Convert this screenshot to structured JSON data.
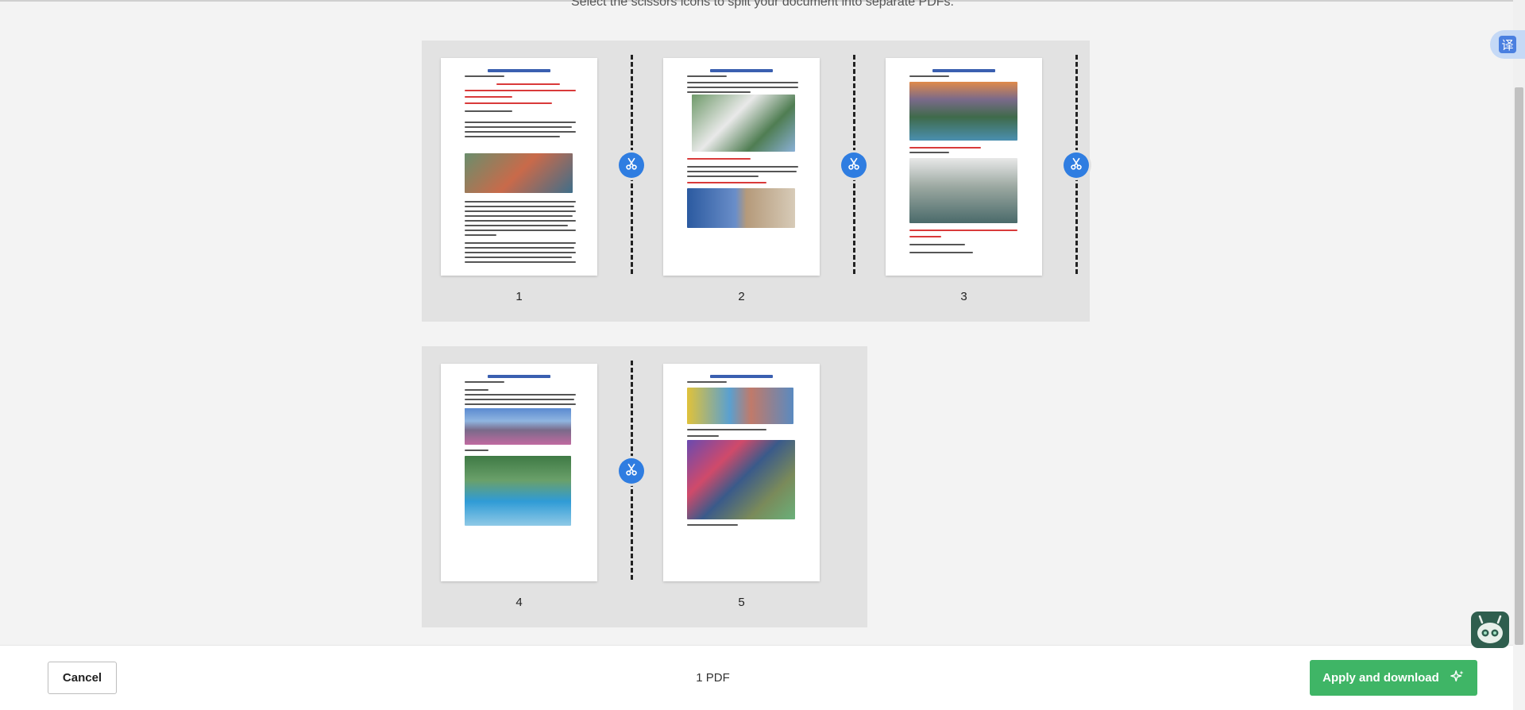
{
  "instruction": "Select the scissors icons to split your document into separate PDFs.",
  "pages": [
    {
      "number": "1"
    },
    {
      "number": "2"
    },
    {
      "number": "3"
    },
    {
      "number": "4"
    },
    {
      "number": "5"
    }
  ],
  "bottom_bar": {
    "cancel_label": "Cancel",
    "pdf_count": "1 PDF",
    "apply_label": "Apply and download"
  },
  "translate_badge": {
    "glyph": "译"
  },
  "colors": {
    "accent_blue": "#2f7de1",
    "apply_green": "#3fb566",
    "group_bg": "#e2e2e2",
    "page_bg": "#f3f3f3"
  }
}
